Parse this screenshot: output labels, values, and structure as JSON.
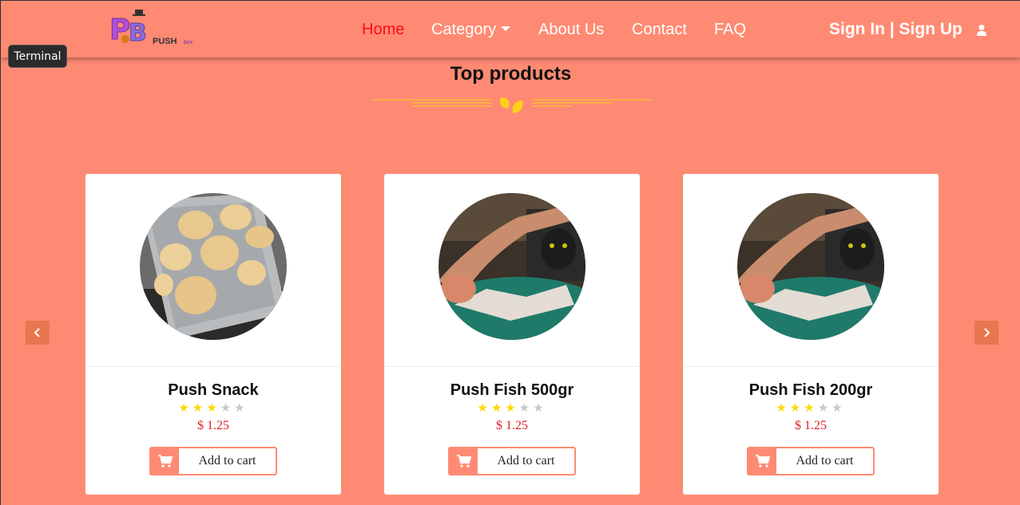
{
  "nav": {
    "home": "Home",
    "category": "Category",
    "about": "About Us",
    "contact": "Contact",
    "faq": "FAQ",
    "sign_in": "Sign In",
    "auth_separator": " | ",
    "sign_up": "Sign Up",
    "active_color": "#ff0a1a"
  },
  "logo": {
    "text": "PUSH",
    "text_small": "box",
    "icon": "pushbox-logo"
  },
  "tooltip": {
    "text": "Terminal"
  },
  "section": {
    "title": "Top products",
    "divider_icon": "leaf-icon"
  },
  "products": [
    {
      "name": "Push Snack",
      "rating": 3,
      "max_rating": 5,
      "price": "$ 1.25",
      "button": "Add to cart",
      "image": "cookies-on-tray"
    },
    {
      "name": "Push Fish 500gr",
      "rating": 3,
      "max_rating": 5,
      "price": "$ 1.25",
      "button": "Add to cart",
      "image": "hand-feeding-cat-fish"
    },
    {
      "name": "Push Fish 200gr",
      "rating": 3,
      "max_rating": 5,
      "price": "$ 1.25",
      "button": "Add to cart",
      "image": "hand-feeding-cat-fish"
    }
  ],
  "colors": {
    "background": "#ff8a73",
    "price": "#e0202a",
    "star": "#ffd700",
    "carousel_button": "#e8764f"
  }
}
